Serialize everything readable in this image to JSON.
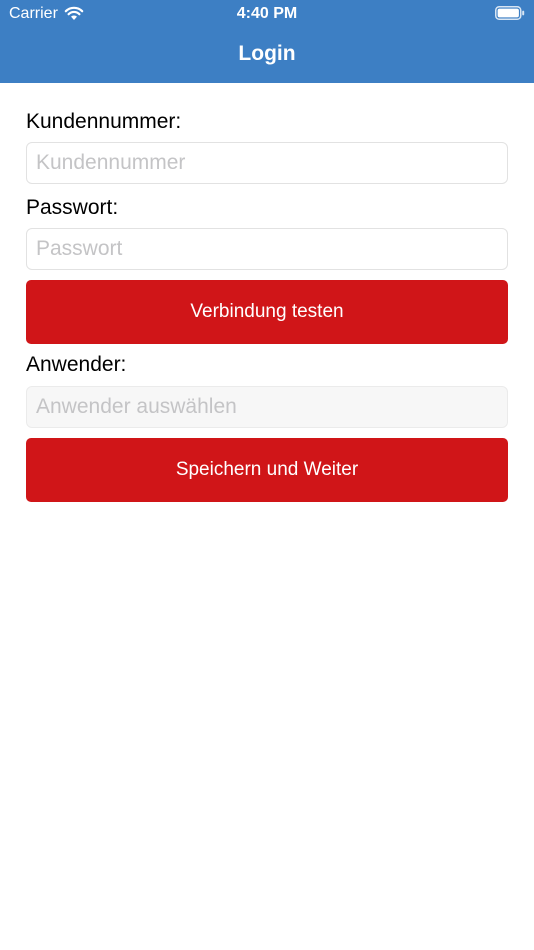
{
  "status_bar": {
    "carrier": "Carrier",
    "time": "4:40 PM",
    "wifi_icon": "wifi-icon",
    "battery_icon": "battery-icon"
  },
  "nav": {
    "title": "Login"
  },
  "form": {
    "customer_number": {
      "label": "Kundennummer:",
      "value": "",
      "placeholder": "Kundennummer"
    },
    "password": {
      "label": "Passwort:",
      "value": "",
      "placeholder": "Passwort"
    },
    "test_button_label": "Verbindung testen",
    "user": {
      "label": "Anwender:",
      "value": "",
      "placeholder": "Anwender auswählen"
    },
    "save_button_label": "Speichern und Weiter"
  },
  "colors": {
    "header": "#3d7fc4",
    "button": "#d01518",
    "placeholder": "#c4c4c6"
  }
}
